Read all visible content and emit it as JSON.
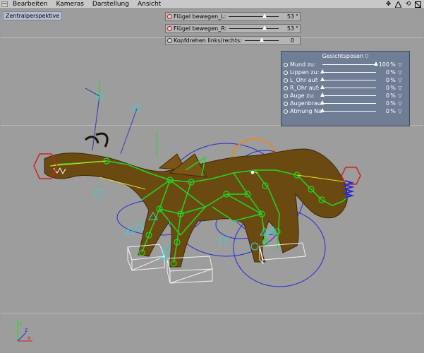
{
  "menubar": {
    "items": [
      "Bearbeiten",
      "Kameras",
      "Darstellung",
      "Ansicht"
    ],
    "icons": [
      "move-icon",
      "maximize-icon",
      "rotate-icon",
      "refresh-icon"
    ]
  },
  "viewport": {
    "label": "Zentralperspektive"
  },
  "sliders": [
    {
      "label": "Flügel bewegen_L:",
      "value": "53",
      "unit": "°",
      "level": 0.72,
      "radio_color": "red"
    },
    {
      "label": "Flügel bewegen_R:",
      "value": "53",
      "unit": "°",
      "level": 0.72,
      "radio_color": "red"
    },
    {
      "label": "Kopfdrehen links/rechts:",
      "value": "0",
      "unit": "",
      "level": 0.5,
      "radio_color": "neutral"
    }
  ],
  "face_panel": {
    "title": "Gesichtsposen",
    "rows": [
      {
        "label": "Mund zu:",
        "value": "100",
        "unit": "%",
        "level": 1.0
      },
      {
        "label": "Lippen zu:",
        "value": "0",
        "unit": "%",
        "level": 0.0
      },
      {
        "label": "L_Ohr auf:",
        "value": "0",
        "unit": "%",
        "level": 0.0
      },
      {
        "label": "R_Ohr auf:",
        "value": "0",
        "unit": "%",
        "level": 0.0
      },
      {
        "label": "Auge zu:",
        "value": "0",
        "unit": "%",
        "level": 0.0
      },
      {
        "label": "Augenbraun ab :",
        "value": "0",
        "unit": "%",
        "level": 0.0
      },
      {
        "label": "Atmung Nase :",
        "value": "0",
        "unit": "%",
        "level": 0.0
      }
    ]
  },
  "colors": {
    "viewport_bg": "#9d9d9d",
    "panel_bg": "#6f7d95",
    "dragon_body": "#6b4a12",
    "rig_green": "#22d622",
    "spline_blue": "#2a2ad8",
    "ik_red": "#d42020",
    "highlight_orange": "#e08a2a"
  }
}
